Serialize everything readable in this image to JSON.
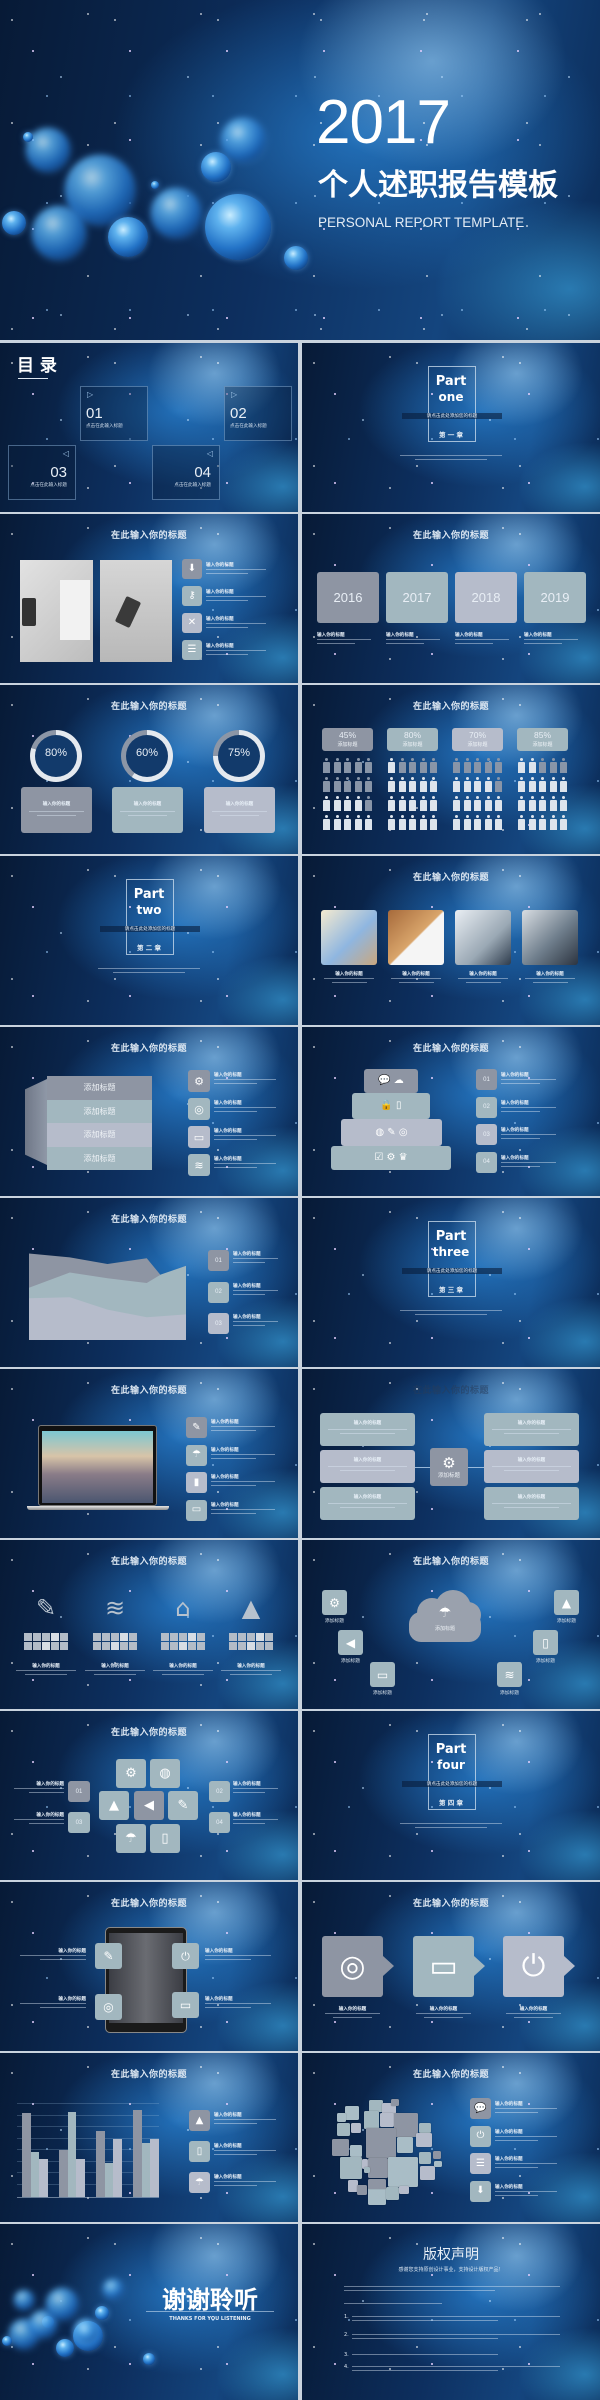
{
  "cover": {
    "year": "2017",
    "title": "个人述职报告模板",
    "subtitle": "PERSONAL REPORT TEMPLATE"
  },
  "labels": {
    "slide_title": "在此输入你的标题",
    "item_title": "输入你的标题",
    "add_title": "添加标题"
  },
  "toc": {
    "heading": "目 录",
    "items": [
      {
        "num": "01",
        "label": "点击在此输入标题"
      },
      {
        "num": "02",
        "label": "点击在此输入标题"
      },
      {
        "num": "03",
        "label": "点击在此输入标题"
      },
      {
        "num": "04",
        "label": "点击在此输入标题"
      }
    ]
  },
  "parts": {
    "one": {
      "word": "Part",
      "name": "one",
      "subtitle": "请点击此处添加您的标题",
      "chapter": "第 一 章"
    },
    "two": {
      "word": "Part",
      "name": "two",
      "subtitle": "请点击此处添加您的标题",
      "chapter": "第 二 章"
    },
    "three": {
      "word": "Part",
      "name": "three",
      "subtitle": "请点击此处添加您的标题",
      "chapter": "第 三 章"
    },
    "four": {
      "word": "Part",
      "name": "four",
      "subtitle": "请点击此处添加您的标题",
      "chapter": "第 四 章"
    }
  },
  "timeline": {
    "years": [
      "2016",
      "2017",
      "2018",
      "2019"
    ]
  },
  "progress_circles": [
    {
      "label": "80%",
      "value": 80
    },
    {
      "label": "60%",
      "value": 60
    },
    {
      "label": "75%",
      "value": 75
    }
  ],
  "people_stats": [
    {
      "label": "45%",
      "value": 45
    },
    {
      "label": "80%",
      "value": 80
    },
    {
      "label": "70%",
      "value": 70
    },
    {
      "label": "85%",
      "value": 85
    }
  ],
  "numbers": [
    "01",
    "02",
    "03",
    "04"
  ],
  "area_chart": {
    "type": "area",
    "layers": [
      [
        91,
        87,
        80,
        86,
        68,
        78
      ],
      [
        55,
        71,
        65,
        60,
        69,
        78
      ],
      [
        44,
        45,
        32,
        24,
        25,
        27
      ]
    ]
  },
  "bar_chart": {
    "type": "bar",
    "groups": [
      [
        93,
        50,
        42
      ],
      [
        52,
        95,
        42
      ],
      [
        73,
        38,
        64
      ],
      [
        97,
        60,
        64
      ]
    ]
  },
  "thanks": {
    "title": "谢谢聆听",
    "subtitle": "THANKS FOR YOU LISTENING"
  },
  "copyright": {
    "title": "版权声明",
    "subtitle": "感谢您支持原创设计事业，支持设计版权产品！",
    "items": [
      "1.",
      "2.",
      "3.",
      "4."
    ]
  },
  "colors": {
    "tile_gray": "#8e95a3",
    "tile_teal": "#a2b7bf",
    "tile_lavender": "#b6bccb",
    "text": "#dbe6f1",
    "bg_dark": "#071a36",
    "bg_blue": "#14457e"
  }
}
